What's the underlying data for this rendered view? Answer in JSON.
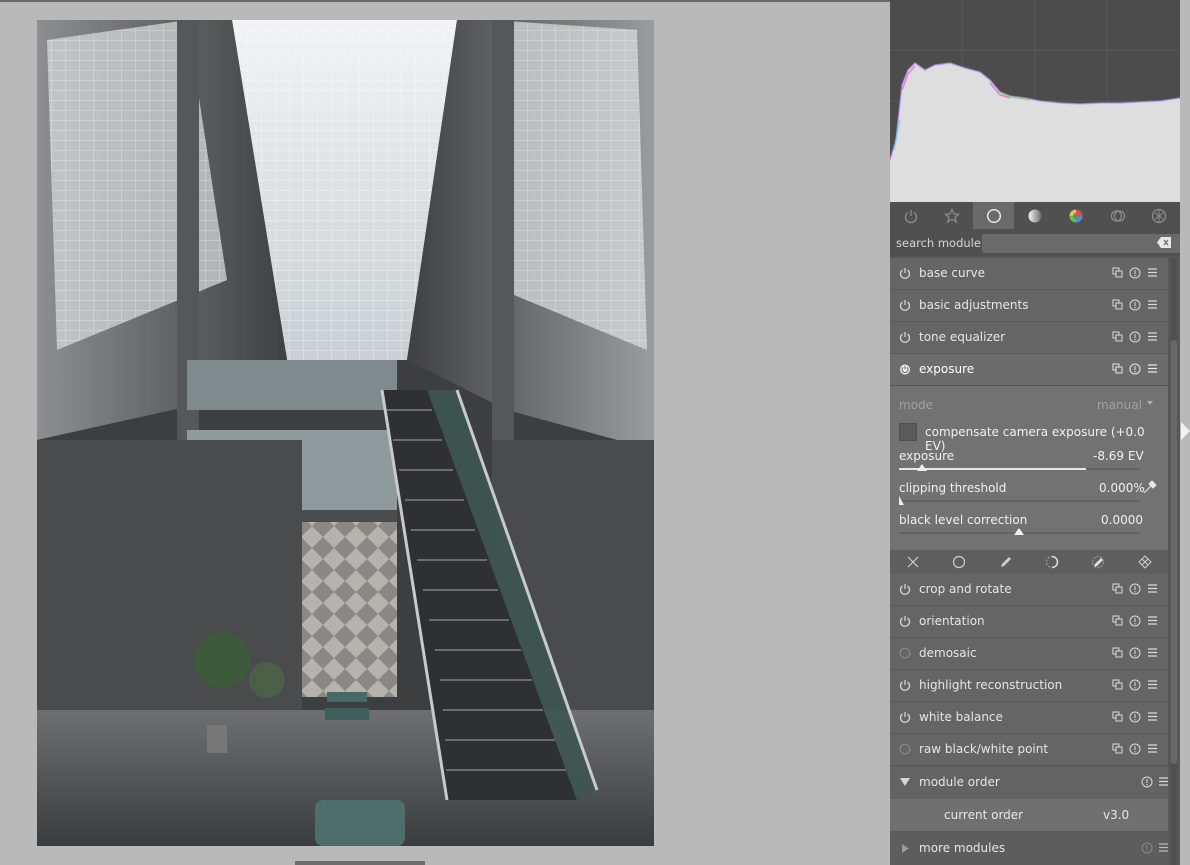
{
  "app": {
    "accent": "#e6e6e6",
    "panel_bg": "#575757"
  },
  "photo": {
    "subject": "indoor atrium with glass skylight and staircase"
  },
  "tabs": [
    {
      "icon": "power-icon",
      "active": false
    },
    {
      "icon": "star-icon",
      "active": false
    },
    {
      "icon": "circle-icon",
      "active": true
    },
    {
      "icon": "tone-gradient-icon",
      "active": false
    },
    {
      "icon": "color-wheel-icon",
      "active": false
    },
    {
      "icon": "correct-icon",
      "active": false
    },
    {
      "icon": "effects-icon",
      "active": false
    }
  ],
  "search": {
    "label": "search module",
    "value": ""
  },
  "modules_top": [
    {
      "name": "base curve",
      "power": true
    },
    {
      "name": "basic adjustments",
      "power": true
    },
    {
      "name": "tone equalizer",
      "power": true
    }
  ],
  "exposure": {
    "name": "exposure",
    "mode_label": "mode",
    "mode_value": "manual",
    "compensate_label": "compensate camera exposure (+0.0 EV)",
    "compensate_checked": false,
    "exposure_label": "exposure",
    "exposure_value": "-8.69 EV",
    "exposure_level": 0.78,
    "clip_label": "clipping threshold",
    "clip_value": "0.000%",
    "clip_level": 0.0,
    "black_label": "black level correction",
    "black_value": "0.0000",
    "black_level": 0.5
  },
  "mask_icons": [
    "close-icon",
    "circle-mask-icon",
    "pencil-icon",
    "parametric-icon",
    "drawn-parametric-icon",
    "raster-icon"
  ],
  "modules_bottom": [
    {
      "name": "crop and rotate",
      "power": true
    },
    {
      "name": "orientation",
      "power": true
    },
    {
      "name": "demosaic",
      "power": false
    },
    {
      "name": "highlight reconstruction",
      "power": true
    },
    {
      "name": "white balance",
      "power": true
    },
    {
      "name": "raw black/white point",
      "power": false
    }
  ],
  "module_order": {
    "name": "module order",
    "current_label": "current order",
    "current_value": "v3.0"
  },
  "more_modules": {
    "name": "more modules"
  }
}
